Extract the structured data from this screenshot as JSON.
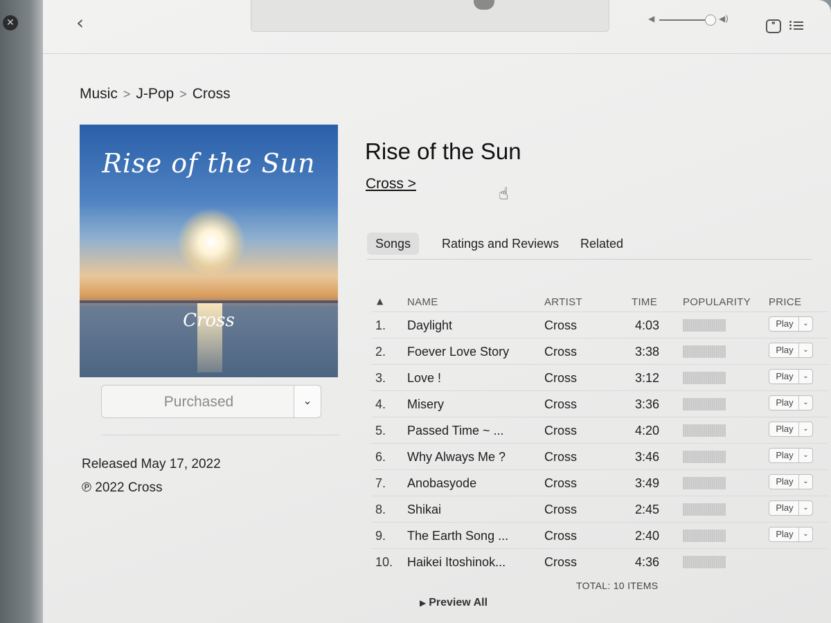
{
  "breadcrumb": [
    "Music",
    "J-Pop",
    "Cross"
  ],
  "album": {
    "title": "Rise of the Sun",
    "artist_link": "Cross >",
    "artwork_title": "Rise of the Sun",
    "artwork_artist": "Cross",
    "purchase_label": "Purchased",
    "released": "Released May 17, 2022",
    "copyright": "℗ 2022 Cross"
  },
  "tabs": [
    "Songs",
    "Ratings and Reviews",
    "Related"
  ],
  "active_tab": "Songs",
  "table": {
    "headers": {
      "sort": "▲",
      "name": "NAME",
      "artist": "ARTIST",
      "time": "TIME",
      "popularity": "POPULARITY",
      "price": "PRICE"
    },
    "rows": [
      {
        "num": "1.",
        "name": "Daylight",
        "artist": "Cross",
        "time": "4:03",
        "play": "Play"
      },
      {
        "num": "2.",
        "name": "Foever Love Story",
        "artist": "Cross",
        "time": "3:38",
        "play": "Play"
      },
      {
        "num": "3.",
        "name": "Love !",
        "artist": "Cross",
        "time": "3:12",
        "play": "Play"
      },
      {
        "num": "4.",
        "name": "Misery",
        "artist": "Cross",
        "time": "3:36",
        "play": "Play"
      },
      {
        "num": "5.",
        "name": "Passed Time ~ ...",
        "artist": "Cross",
        "time": "4:20",
        "play": "Play"
      },
      {
        "num": "6.",
        "name": "Why Always Me ?",
        "artist": "Cross",
        "time": "3:46",
        "play": "Play"
      },
      {
        "num": "7.",
        "name": "Anobasyode",
        "artist": "Cross",
        "time": "3:49",
        "play": "Play"
      },
      {
        "num": "8.",
        "name": "Shikai",
        "artist": "Cross",
        "time": "2:45",
        "play": "Play"
      },
      {
        "num": "9.",
        "name": "The Earth Song ...",
        "artist": "Cross",
        "time": "2:40",
        "play": "Play"
      },
      {
        "num": "10.",
        "name": "Haikei Itoshinok...",
        "artist": "Cross",
        "time": "4:36",
        "play": ""
      }
    ],
    "total": "TOTAL: 10 ITEMS",
    "preview_all": "Preview All"
  },
  "icons": {
    "close": "close-icon",
    "back": "chevron-left-icon",
    "volume_low": "speaker-low-icon",
    "volume_high": "speaker-high-icon",
    "lyrics": "lyrics-icon",
    "queue": "list-icon",
    "dropdown": "chevron-down-icon",
    "cursor": "hand-pointer-icon"
  }
}
